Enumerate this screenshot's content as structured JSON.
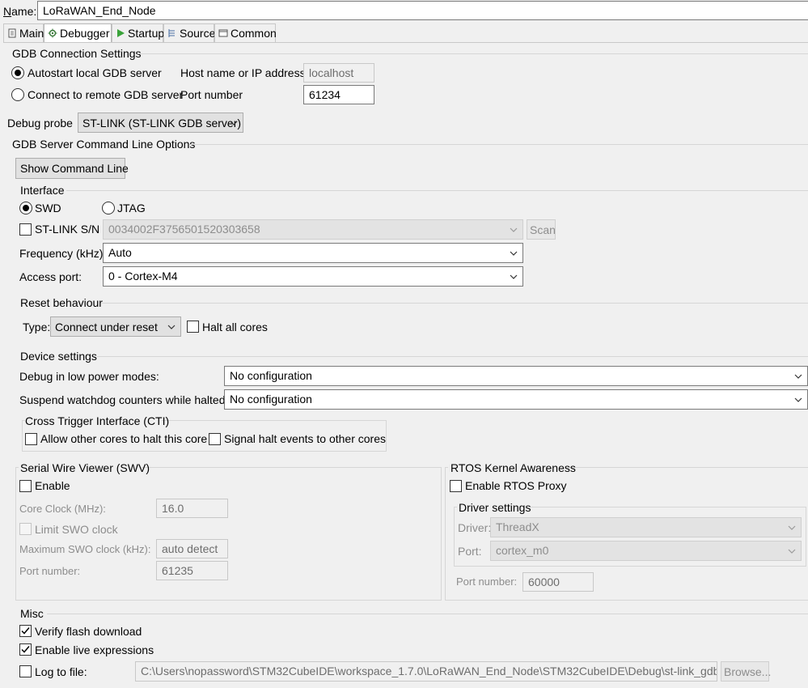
{
  "name": {
    "label": "Name:",
    "value": "LoRaWAN_End_Node"
  },
  "tabs": [
    {
      "label": "Main",
      "icon": "document-icon"
    },
    {
      "label": "Debugger",
      "icon": "debug-gear-icon"
    },
    {
      "label": "Startup",
      "icon": "play-icon"
    },
    {
      "label": "Source",
      "icon": "source-icon"
    },
    {
      "label": "Common",
      "icon": "common-icon"
    }
  ],
  "gdb_connection": {
    "title": "GDB Connection Settings",
    "autostart_label": "Autostart local GDB server",
    "remote_label": "Connect to remote GDB server",
    "host_label": "Host name or IP address",
    "host_value": "localhost",
    "port_label": "Port number",
    "port_value": "61234",
    "selected": "autostart"
  },
  "debug_probe": {
    "label": "Debug probe",
    "value": "ST-LINK (ST-LINK GDB server)"
  },
  "gdb_server": {
    "title": "GDB Server Command Line Options",
    "show_cmd_label": "Show Command Line"
  },
  "interface": {
    "title": "Interface",
    "swd_label": "SWD",
    "jtag_label": "JTAG",
    "selected": "SWD",
    "stlink_sn_label": "ST-LINK S/N",
    "stlink_sn_value": "0034002F3756501520303658",
    "scan_label": "Scan",
    "frequency_label": "Frequency (kHz):",
    "frequency_value": "Auto",
    "access_port_label": "Access port:",
    "access_port_value": "0 - Cortex-M4"
  },
  "reset": {
    "title": "Reset behaviour",
    "type_label": "Type:",
    "type_value": "Connect under reset",
    "halt_all_label": "Halt all cores"
  },
  "device": {
    "title": "Device settings",
    "low_power_label": "Debug in low power modes:",
    "low_power_value": "No configuration",
    "watchdog_label": "Suspend watchdog counters while halted:",
    "watchdog_value": "No configuration",
    "cti_title": "Cross Trigger Interface (CTI)",
    "cti_allow_label": "Allow other cores to halt this core",
    "cti_signal_label": "Signal halt events to other cores"
  },
  "swv": {
    "title": "Serial Wire Viewer (SWV)",
    "enable_label": "Enable",
    "core_clock_label": "Core Clock (MHz):",
    "core_clock_value": "16.0",
    "limit_swo_label": "Limit SWO clock",
    "max_swo_label": "Maximum SWO clock (kHz):",
    "max_swo_value": "auto detect",
    "port_label": "Port number:",
    "port_value": "61235"
  },
  "rtos": {
    "title": "RTOS Kernel Awareness",
    "enable_label": "Enable RTOS Proxy",
    "driver_settings_title": "Driver settings",
    "driver_label": "Driver:",
    "driver_value": "ThreadX",
    "port_label": "Port:",
    "port_value": "cortex_m0",
    "port_number_label": "Port number:",
    "port_number_value": "60000"
  },
  "misc": {
    "title": "Misc",
    "verify_label": "Verify flash download",
    "verify_checked": true,
    "live_expr_label": "Enable live expressions",
    "live_expr_checked": true,
    "log_label": "Log to file:",
    "log_path": "C:\\Users\\nopassword\\STM32CubeIDE\\workspace_1.7.0\\LoRaWAN_End_Node\\STM32CubeIDE\\Debug\\st-link_gdbserver_log.txt",
    "browse_label": "Browse..."
  }
}
